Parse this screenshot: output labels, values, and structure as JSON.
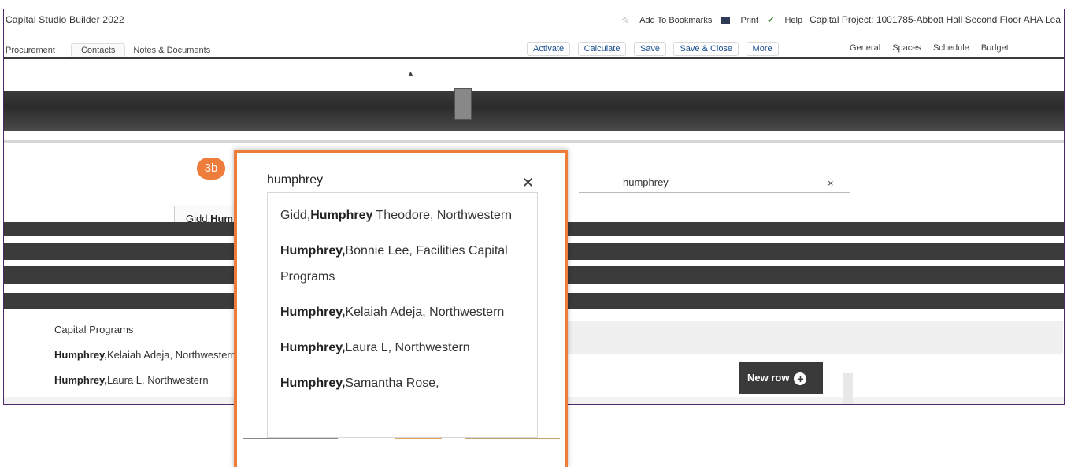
{
  "app": {
    "title": "Capital Studio Builder 2022",
    "top_links": [
      "Add To Bookmarks",
      "Print",
      "Help"
    ],
    "project": "Capital Project: 1001785-Abbott Hall Second Floor AHA Lea"
  },
  "nav": {
    "left": [
      "Procurement",
      "Contacts",
      "Notes & Documents"
    ],
    "toolbar": [
      "Activate",
      "Calculate",
      "Save",
      "Save & Close",
      "More"
    ],
    "right": [
      "General",
      "Spaces",
      "Schedule",
      "Budget"
    ]
  },
  "background_search": {
    "value": "humphrey",
    "peek_first": "Gidd,",
    "peek_bold": "Hum"
  },
  "background_list": [
    {
      "bold": "",
      "rest": "Capital Programs"
    },
    {
      "bold": "Humphrey,",
      "rest": "Kelaiah Adeja, Northwestern"
    },
    {
      "bold": "Humphrey,",
      "rest": "Laura L, Northwestern"
    }
  ],
  "new_row": {
    "label": "New row"
  },
  "callout": {
    "badge": "3b",
    "search_value": "humphrey",
    "options": [
      {
        "pre": "Gidd,",
        "bold": "Humphrey",
        "post": " Theodore, Northwestern"
      },
      {
        "pre": "",
        "bold": "Humphrey,",
        "post": "Bonnie Lee, Facilities Capital Programs"
      },
      {
        "pre": "",
        "bold": "Humphrey,",
        "post": "Kelaiah Adeja, Northwestern"
      },
      {
        "pre": "",
        "bold": "Humphrey,",
        "post": "Laura L, Northwestern"
      },
      {
        "pre": "",
        "bold": "Humphrey,",
        "post": "Samantha Rose,"
      }
    ]
  },
  "colors": {
    "accent": "#ee7c3a",
    "frame": "#4a2a6b",
    "dark": "#3a3a3a"
  },
  "icons": [
    "bookmark-star-icon",
    "print-icon",
    "help-icon",
    "close-icon",
    "plus-icon",
    "scroll-up-icon"
  ]
}
